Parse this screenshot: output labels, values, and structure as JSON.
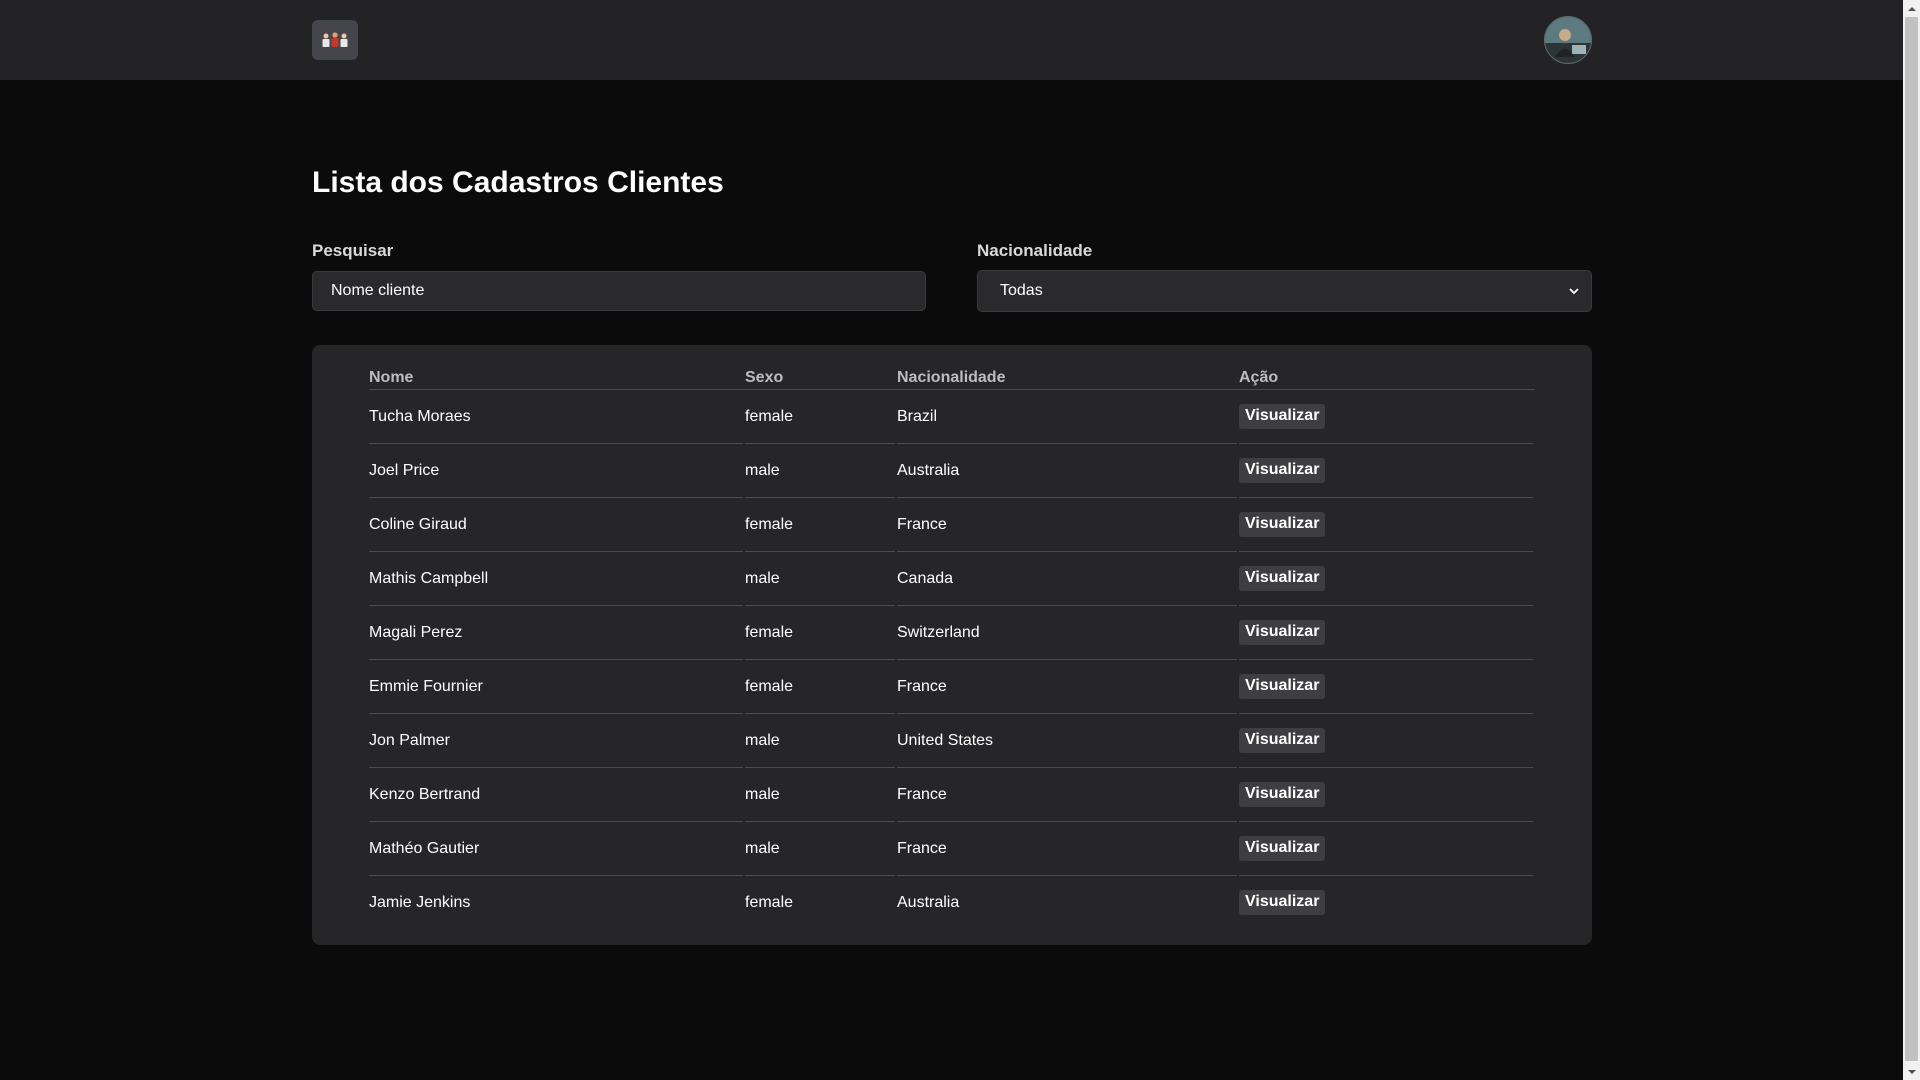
{
  "header": {
    "logo_icon": "people-group-icon",
    "avatar_icon": "user-avatar-icon"
  },
  "page": {
    "title": "Lista dos Cadastros Clientes"
  },
  "filters": {
    "search_label": "Pesquisar",
    "search_placeholder": "Nome cliente",
    "nationality_label": "Nacionalidade",
    "nationality_selected": "Todas"
  },
  "table": {
    "headers": [
      "Nome",
      "Sexo",
      "Nacionalidade",
      "Ação"
    ],
    "rows": [
      {
        "name": "Tucha Moraes",
        "sex": "female",
        "nationality": "Brazil",
        "action": "Visualizar"
      },
      {
        "name": "Joel Price",
        "sex": "male",
        "nationality": "Australia",
        "action": "Visualizar"
      },
      {
        "name": "Coline Giraud",
        "sex": "female",
        "nationality": "France",
        "action": "Visualizar"
      },
      {
        "name": "Mathis Campbell",
        "sex": "male",
        "nationality": "Canada",
        "action": "Visualizar"
      },
      {
        "name": "Magali Perez",
        "sex": "female",
        "nationality": "Switzerland",
        "action": "Visualizar"
      },
      {
        "name": "Emmie Fournier",
        "sex": "female",
        "nationality": "France",
        "action": "Visualizar"
      },
      {
        "name": "Jon Palmer",
        "sex": "male",
        "nationality": "United States",
        "action": "Visualizar"
      },
      {
        "name": "Kenzo Bertrand",
        "sex": "male",
        "nationality": "France",
        "action": "Visualizar"
      },
      {
        "name": "Mathéo Gautier",
        "sex": "male",
        "nationality": "France",
        "action": "Visualizar"
      },
      {
        "name": "Jamie Jenkins",
        "sex": "female",
        "nationality": "Australia",
        "action": "Visualizar"
      }
    ]
  },
  "colors": {
    "background": "#0b0b0b",
    "navbar": "#232325",
    "panel": "#262628",
    "button": "#3e3e42"
  }
}
